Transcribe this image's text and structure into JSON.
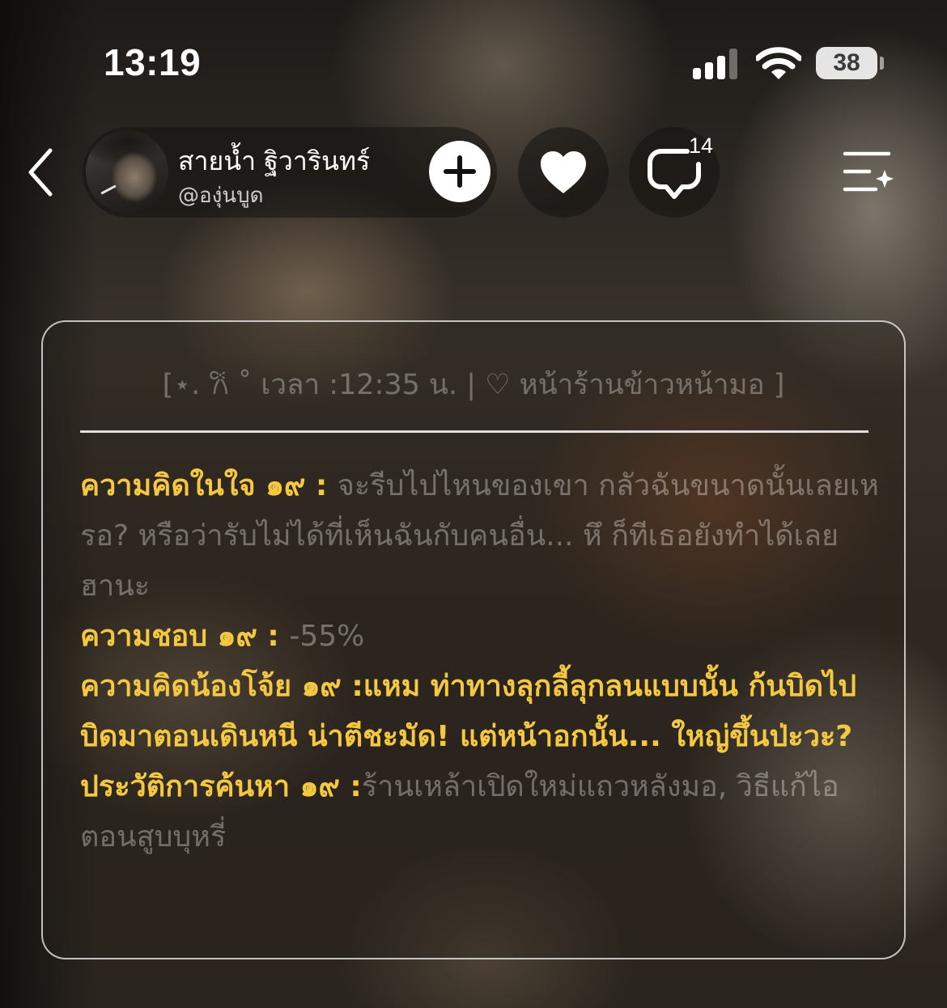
{
  "status_bar": {
    "time": "13:19",
    "battery": "38"
  },
  "header": {
    "profile_name": "สายน้ำ ฐิวารินทร์",
    "profile_handle": "@องุ่นบูด",
    "comment_count": "14"
  },
  "card": {
    "header": "[⋆. 𐙚 ˚ เวลา :12:35 น. | ♡ หน้าร้านข้าวหน้ามอ ]",
    "rows": [
      {
        "label": "ความคิดในใจ ๑๙ : ",
        "value": "จะรีบไปไหนของเขา กลัวฉันขนาดนั้นเลยเหรอ? หรือว่ารับไม่ได้ที่เห็นฉันกับคนอื่น... หึ ก็ทีเธอยังทำได้เลย ฮานะ"
      },
      {
        "label": "ความชอบ ๑๙ : ",
        "value": "-55%"
      },
      {
        "label": "ความคิดน้องโจ้ย ๑๙ :",
        "value": "แหม ท่าทางลุกลี้ลุกลนแบบนั้น ก้นบิดไปบิดมาตอนเดินหนี น่าตีชะมัด! แต่หน้าอกนั้น... ใหญ่ขึ้นป่ะวะ?"
      },
      {
        "label": "ประวัติการค้นหา ๑๙ :",
        "value": "ร้านเหล้าเปิดใหม่แถวหลังมอ, วิธีแก้ไอตอนสูบบุหรี่"
      }
    ]
  },
  "colors": {
    "label": "#f5c842",
    "muted_text": "rgba(255,255,255,0.34)",
    "card_border": "rgba(255,255,255,0.72)"
  },
  "icons": [
    "back-chevron-icon",
    "plus-icon",
    "heart-icon",
    "comment-bubble-icon",
    "menu-sparkle-icon",
    "signal-icon",
    "wifi-icon",
    "battery-icon"
  ]
}
